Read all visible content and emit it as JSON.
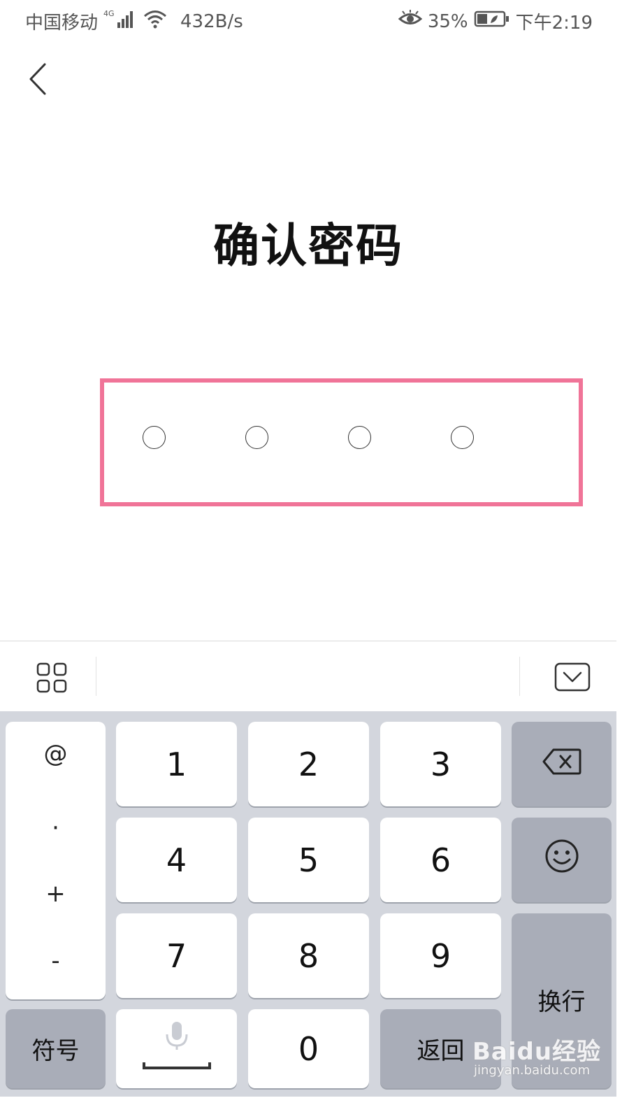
{
  "status_bar": {
    "carrier": "中国移动",
    "network_badge": "4G",
    "speed": "432B/s",
    "battery": "35%",
    "time": "下午2:19",
    "icons": [
      "signal-icon",
      "wifi-icon",
      "eye-care-icon",
      "battery-icon"
    ]
  },
  "header": {
    "back_icon": "chevron-left-icon",
    "title": "确认密码"
  },
  "pin": {
    "length": 4,
    "filled": 0,
    "highlight_color": "#f07498"
  },
  "keyboard": {
    "toolbar": {
      "left_icon": "grid-icon",
      "right_icon": "hide-keyboard-icon"
    },
    "symbols": [
      "@",
      "·",
      "+",
      "-"
    ],
    "digits": [
      "1",
      "2",
      "3",
      "4",
      "5",
      "6",
      "7",
      "8",
      "9",
      "0"
    ],
    "symbol_key": "符号",
    "return_key": "返回",
    "newline_key": "换行",
    "backspace_icon": "backspace-icon",
    "emoji_icon": "emoji-icon",
    "space_icon": "microphone-icon"
  },
  "watermark": {
    "logo_text": "Baidu经验",
    "url": "jingyan.baidu.com"
  },
  "colors": {
    "keyboard_bg": "#d3d6dd",
    "key_white": "#ffffff",
    "key_gray": "#a9adb8"
  }
}
